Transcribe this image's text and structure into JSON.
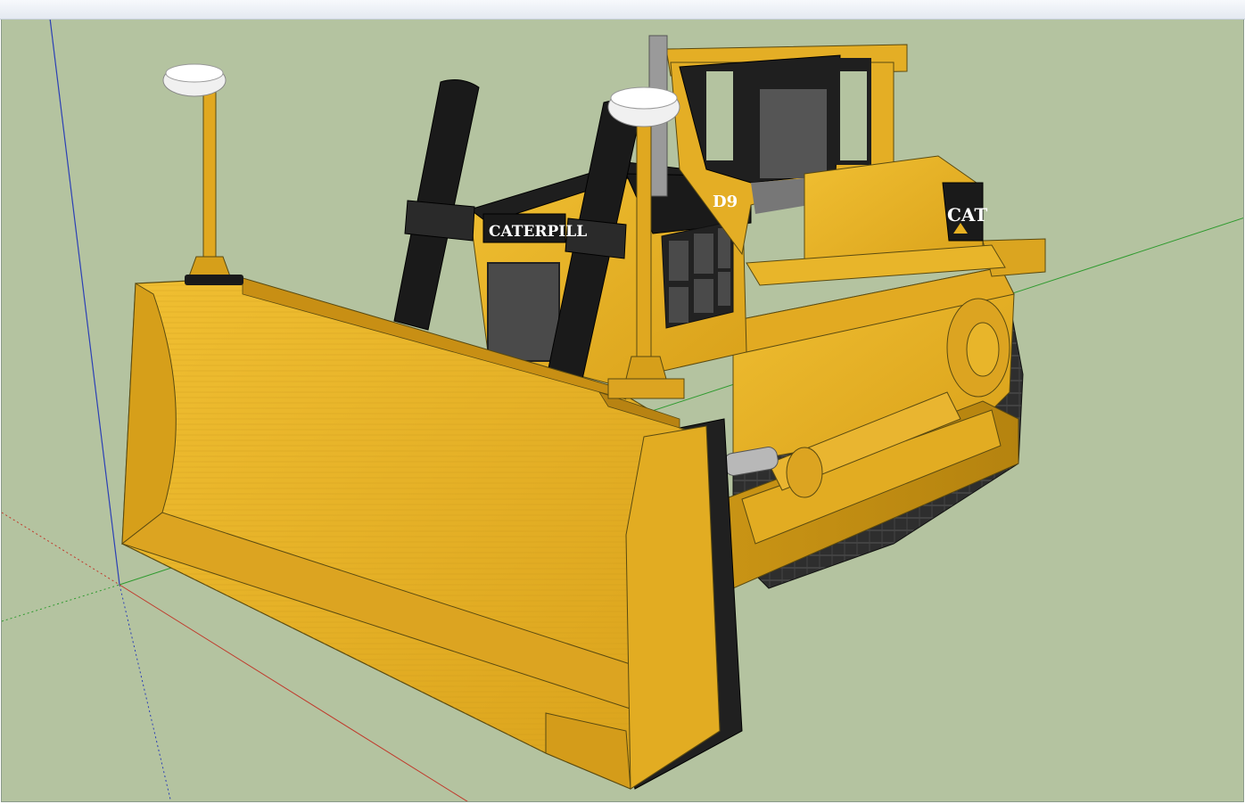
{
  "window": {
    "title": ""
  },
  "model": {
    "blade_brand_text": "CATERPILL",
    "model_text": "D9",
    "logo_text": "CAT"
  },
  "colors": {
    "background": "#b4c3a0",
    "body_yellow": "#e6b022",
    "body_shadow": "#c18d12",
    "track_black": "#2b2b2b",
    "axis_red": "#c0392b",
    "axis_green": "#2e9a2e",
    "axis_blue": "#2b3fb5"
  },
  "icons": {
    "axes": "axes-icon",
    "gps_antenna": "gps-antenna-icon"
  }
}
